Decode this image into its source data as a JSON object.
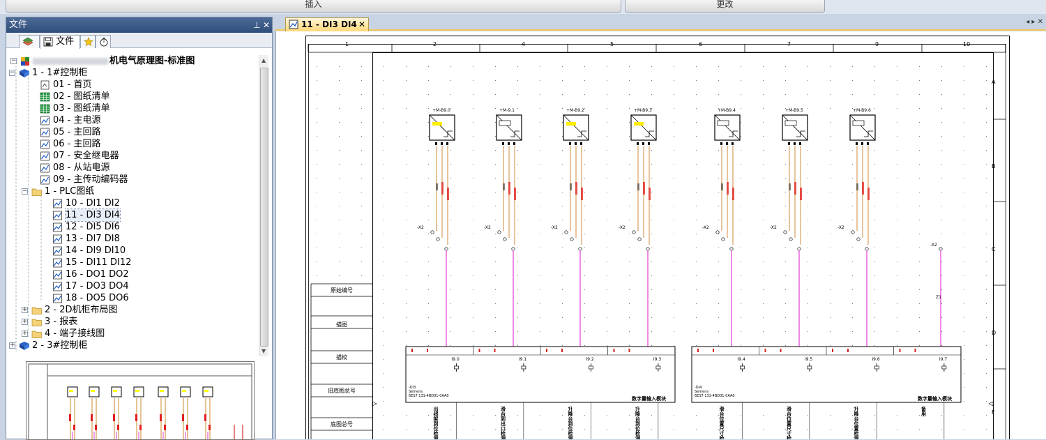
{
  "ribbon": {
    "insert_label": "插入",
    "change_label": "更改"
  },
  "file_panel": {
    "title": "文件",
    "pin_icon": "pin-icon",
    "close_icon": "close-icon",
    "tabs": [
      {
        "label": "",
        "icon": "layers-icon"
      },
      {
        "label": "文件",
        "icon": "save-icon"
      },
      {
        "label": "",
        "icon": "star-icon"
      },
      {
        "label": "",
        "icon": "timer-icon"
      }
    ]
  },
  "tree": {
    "root_label": "机电气原理图-标准图",
    "items": [
      {
        "label": "1 - 1#控制柜",
        "type": "cabinet",
        "expander": "−"
      },
      {
        "label": "01 - 首页",
        "type": "page"
      },
      {
        "label": "02 - 图纸清单",
        "type": "table"
      },
      {
        "label": "03 - 图纸清单",
        "type": "table"
      },
      {
        "label": "04 - 主电源",
        "type": "schematic"
      },
      {
        "label": "05 - 主回路",
        "type": "schematic"
      },
      {
        "label": "06 - 主回路",
        "type": "schematic"
      },
      {
        "label": "07 - 安全继电器",
        "type": "schematic"
      },
      {
        "label": "08 - 从站电源",
        "type": "schematic"
      },
      {
        "label": "09 - 主传动编码器",
        "type": "schematic"
      },
      {
        "label": "1 - PLC图纸",
        "type": "folder",
        "expander": "−"
      },
      {
        "label": "10 - DI1 DI2",
        "type": "schematic"
      },
      {
        "label": "11 - DI3 DI4",
        "type": "schematic",
        "selected": true
      },
      {
        "label": "12 - DI5 DI6",
        "type": "schematic"
      },
      {
        "label": "13 - DI7 DI8",
        "type": "schematic"
      },
      {
        "label": "14 - DI9 DI10",
        "type": "schematic"
      },
      {
        "label": "15 - DI11 DI12",
        "type": "schematic"
      },
      {
        "label": "16 - DO1 DO2",
        "type": "schematic"
      },
      {
        "label": "17 - DO3 DO4",
        "type": "schematic"
      },
      {
        "label": "18 - DO5 DO6",
        "type": "schematic"
      },
      {
        "label": "2 - 2D机柜布局图",
        "type": "folder",
        "expander": "+"
      },
      {
        "label": "3 - 报表",
        "type": "folder",
        "expander": "+"
      },
      {
        "label": "4 - 端子接线图",
        "type": "folder",
        "expander": "+"
      },
      {
        "label": "2 - 3#控制柜",
        "type": "cabinet",
        "expander": "+"
      }
    ]
  },
  "document": {
    "tab_label": "11 - DI3 DI4",
    "tab_nav": "◂ ▸ ✕",
    "column_numbers": [
      "1",
      "2",
      "4",
      "5",
      "6",
      "7",
      "9",
      "10"
    ],
    "row_letters": [
      "A",
      "B",
      "C",
      "D",
      "F"
    ],
    "side_labels": [
      "原始编号",
      "描图",
      "描校",
      "旧底图总号",
      "底图总号"
    ],
    "sensor_tags": [
      "+M-B9.0",
      "+M-9.1",
      "+M-B9.2",
      "+M-B9.3",
      "+M-B9.4",
      "+M-B9.5",
      "+M-B9.6"
    ],
    "terminal_tag": "-X2",
    "wire_tag": "Z1",
    "modules": [
      {
        "designation": "-DI3",
        "maker": "Semens",
        "part": "6ES7 131-4BD01-0AA0",
        "title": "数字量输入模块",
        "channels": [
          "I9.0",
          "I9.1",
          "I9.2",
          "I9.3"
        ],
        "descriptions": [
          "出线架到位检测",
          "滑台到出口检测",
          "升降台到位检测",
          "升降台到位检测"
        ]
      },
      {
        "designation": "-DI4",
        "maker": "Semens",
        "part": "6ES7 131-4BD01-0AA0",
        "title": "数字量输入模块",
        "channels": [
          "I9.4",
          "I9.5",
          "I9.6",
          "I9.7"
        ],
        "descriptions": [
          "滑台位置尺寸检测",
          "滑台位置尺寸检测",
          "升降台位置检测",
          "备用"
        ]
      }
    ]
  },
  "colors": {
    "wire_pink": "#e23ad1",
    "wire_orange": "#d08a3a",
    "accent_tab": "#f2c85b",
    "panel_title": "#3a5783"
  }
}
